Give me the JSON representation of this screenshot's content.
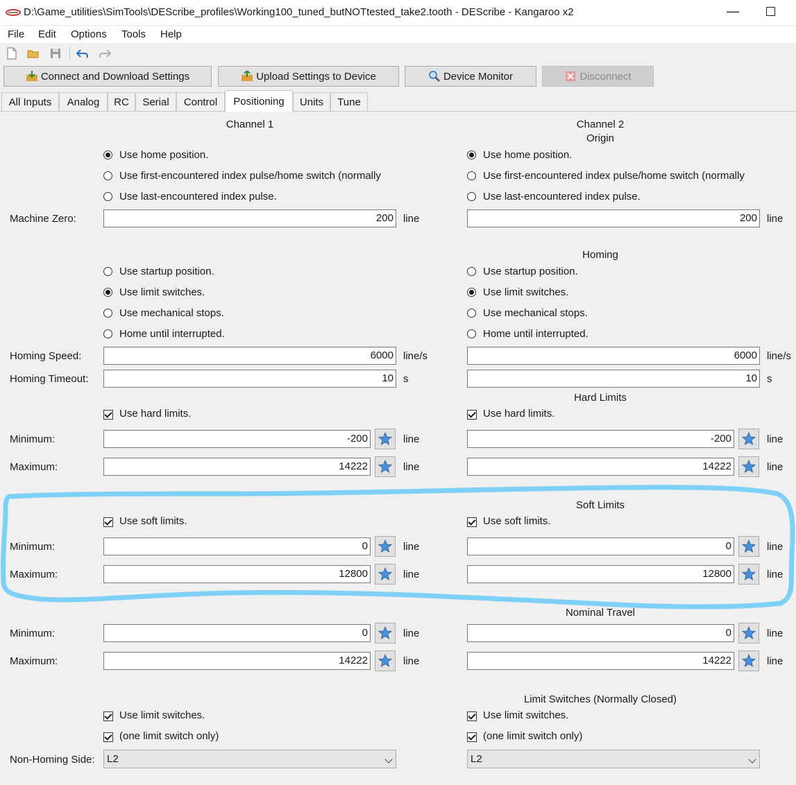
{
  "window": {
    "title": "D:\\Game_utilities\\SimTools\\DEScribe_profiles\\Working100_tuned_butNOTtested_take2.tooth - DEScribe - Kangaroo x2",
    "minimize_glyph": "—"
  },
  "menu": [
    "File",
    "Edit",
    "Options",
    "Tools",
    "Help"
  ],
  "toolbar_icons": [
    "new-file-icon",
    "open-folder-icon",
    "save-icon",
    "undo-icon",
    "redo-icon"
  ],
  "buttons": {
    "connect": "Connect and Download Settings",
    "upload": "Upload Settings to Device",
    "monitor": "Device Monitor",
    "disconnect": "Disconnect"
  },
  "tabs": [
    "All Inputs",
    "Analog",
    "RC",
    "Serial",
    "Control",
    "Positioning",
    "Units",
    "Tune"
  ],
  "active_tab": "Positioning",
  "headers": {
    "channel1": "Channel 1",
    "channel2": "Channel 2",
    "origin": "Origin",
    "homing": "Homing",
    "hard_limits": "Hard Limits",
    "soft_limits": "Soft Limits",
    "nominal_travel": "Nominal Travel",
    "limit_switches": "Limit Switches (Normally Closed)"
  },
  "labels": {
    "machine_zero": "Machine Zero:",
    "homing_speed": "Homing Speed:",
    "homing_timeout": "Homing Timeout:",
    "minimum": "Minimum:",
    "maximum": "Maximum:",
    "non_homing_side": "Non-Homing Side:"
  },
  "units": {
    "line": "line",
    "line_s": "line/s",
    "s": "s"
  },
  "origin_options": [
    "Use home position.",
    "Use first-encountered index pulse/home switch (normally",
    "Use last-encountered index pulse."
  ],
  "homing_options": [
    "Use startup position.",
    "Use limit switches.",
    "Use mechanical stops.",
    "Home until interrupted."
  ],
  "check_labels": {
    "hard": "Use hard limits.",
    "soft": "Use soft limits.",
    "limit_switches": "Use limit switches.",
    "one_switch": "(one limit switch only)"
  },
  "ch1": {
    "origin_selected": 0,
    "machine_zero": "200",
    "homing_selected": 1,
    "homing_speed": "6000",
    "homing_timeout": "10",
    "hard_enabled": true,
    "hard_min": "-200",
    "hard_max": "14222",
    "soft_enabled": true,
    "soft_min": "0",
    "soft_max": "12800",
    "nominal_min": "0",
    "nominal_max": "14222",
    "limit_switches": true,
    "one_switch": true,
    "non_homing_side": "L2"
  },
  "ch2": {
    "origin_selected": 0,
    "machine_zero": "200",
    "homing_selected": 1,
    "homing_speed": "6000",
    "homing_timeout": "10",
    "hard_enabled": true,
    "hard_min": "-200",
    "hard_max": "14222",
    "soft_enabled": true,
    "soft_min": "0",
    "soft_max": "12800",
    "nominal_min": "0",
    "nominal_max": "14222",
    "limit_switches": true,
    "one_switch": true,
    "non_homing_side": "L2"
  },
  "colors": {
    "highlight": "#7fd0f7",
    "star": "#4a90d9"
  }
}
